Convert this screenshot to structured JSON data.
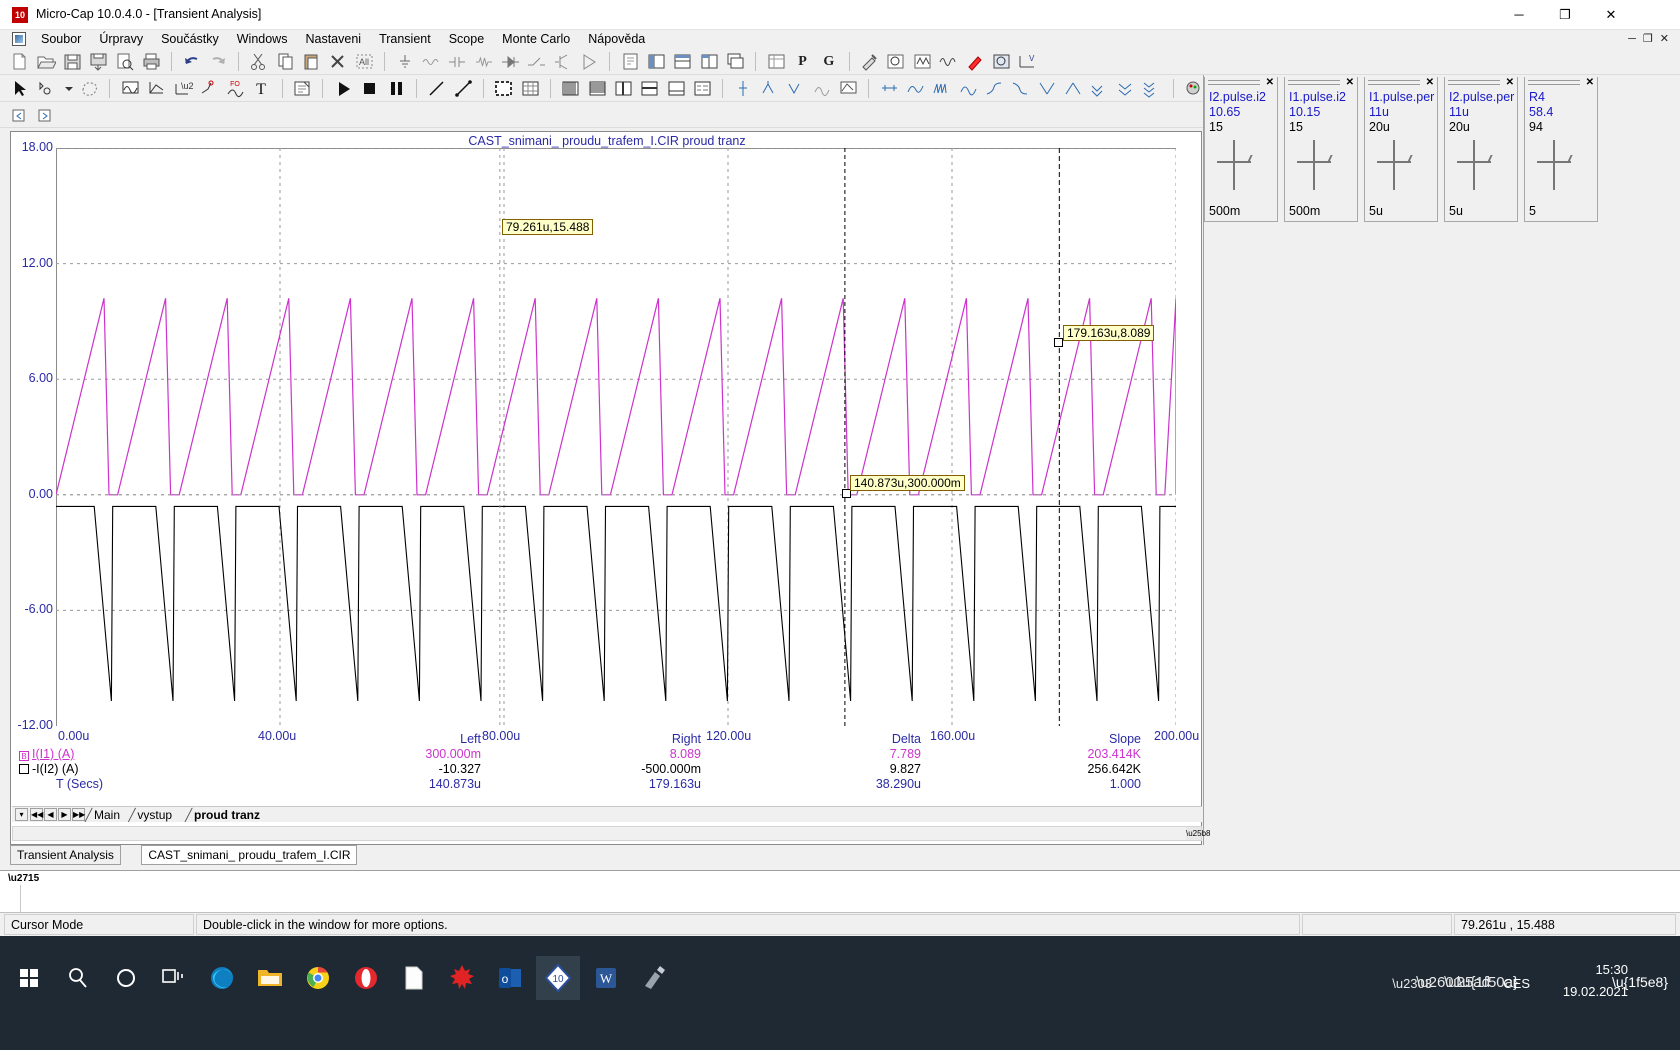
{
  "window": {
    "title": "Micro-Cap 10.0.4.0 - [Transient Analysis]",
    "app_badge": "10",
    "minimize": "─",
    "maximize": "❐",
    "close": "✕",
    "mdi_minimize": "─",
    "mdi_restore": "❐",
    "mdi_close": "✕"
  },
  "menu": {
    "items": [
      {
        "label": "Soubor"
      },
      {
        "label": "Úrpravy"
      },
      {
        "label": "Součástky"
      },
      {
        "label": "Windows"
      },
      {
        "label": "Nastaveni"
      },
      {
        "label": "Transient"
      },
      {
        "label": "Scope"
      },
      {
        "label": "Monte Carlo"
      },
      {
        "label": "Nápověda"
      }
    ]
  },
  "toolbar_text": {
    "probe_p": "P",
    "probe_g": "G",
    "quote_p": "'P'",
    "font_f": "F"
  },
  "sliders": [
    {
      "name": "I2.pulse.i2",
      "value": "10.65",
      "max": "15",
      "min": "500m"
    },
    {
      "name": "I1.pulse.i2",
      "value": "10.15",
      "max": "15",
      "min": "500m"
    },
    {
      "name": "I1.pulse.per",
      "value": "11u",
      "max": "20u",
      "min": "5u"
    },
    {
      "name": "I2.pulse.per",
      "value": "11u",
      "max": "20u",
      "min": "5u"
    },
    {
      "name": "R4",
      "value": "58.4",
      "max": "94",
      "min": "5"
    }
  ],
  "plot": {
    "title": "CAST_snimani_ proudu_trafem_I.CIR proud tranz",
    "y_ticks": [
      "18.00",
      "12.00",
      "6.00",
      "0.00",
      "-6.00",
      "-12.00"
    ],
    "x_ticks": [
      "0.00u",
      "40.00u",
      "80.00u",
      "120.00u",
      "160.00u",
      "200.00u"
    ],
    "tooltips": [
      {
        "text": "79.261u,15.488"
      },
      {
        "text": "140.873u,300.000m"
      },
      {
        "text": "179.163u,8.089"
      }
    ]
  },
  "chart_data": {
    "type": "line",
    "title": "CAST_snimani_ proudu_trafem_I.CIR proud tranz",
    "xlabel": "T (Secs)",
    "ylabel": "",
    "xlim": [
      0,
      200
    ],
    "ylim": [
      -12,
      18
    ],
    "x_unit": "u",
    "grid": true,
    "x_ticks": [
      0,
      40,
      80,
      120,
      160,
      200
    ],
    "y_ticks": [
      18,
      12,
      6,
      0,
      -6,
      -12
    ],
    "series": [
      {
        "name": "I(I1) (A)",
        "color": "#cc33cc",
        "description": "Sawtooth current ramp rising from 0 to about 10.2 A then dropping sharply to 0; period 11 us",
        "period_us": 11,
        "peak": 10.2,
        "baseline": 0.0
      },
      {
        "name": "-I(I2) (A)",
        "color": "#000000",
        "description": "Inverted sawtooth falling from about -0.6 to -10.7 A then jumping back; period 11 us",
        "period_us": 11,
        "peak": -0.6,
        "baseline": -10.7
      }
    ]
  },
  "readout": {
    "columns": [
      "Left",
      "Right",
      "Delta",
      "Slope"
    ],
    "rows": [
      {
        "label": "I(I1) (A)",
        "marker": "B",
        "color": "#cc33cc",
        "left": "300.000m",
        "right": "8.089",
        "delta": "7.789",
        "slope": "203.414K"
      },
      {
        "label": "-I(I2) (A)",
        "marker": "",
        "color": "#000000",
        "left": "-10.327",
        "right": "-500.000m",
        "delta": "9.827",
        "slope": "256.642K"
      },
      {
        "label": "T (Secs)",
        "marker": "",
        "color": "#2a2aa5",
        "left": "140.873u",
        "right": "179.163u",
        "delta": "38.290u",
        "slope": "1.000"
      }
    ]
  },
  "page_tabs": {
    "first": "◀◀",
    "prev": "◀",
    "next": "▶",
    "last": "▶▶",
    "dropdown": "▾",
    "items": [
      {
        "label": "Main",
        "active": false
      },
      {
        "label": "vystup",
        "active": false
      },
      {
        "label": "proud tranz",
        "active": true
      }
    ]
  },
  "doc_tabs": [
    {
      "label": "Transient Analysis",
      "selected": false
    },
    {
      "label": "CAST_snimani_ proudu_trafem_I.CIR",
      "selected": true
    }
  ],
  "statusbar": {
    "mode": "Cursor Mode",
    "hint": "Double-click in the window for more options.",
    "field3": "",
    "coords": "79.261u , 15.488"
  },
  "taskbar": {
    "items": [
      {
        "name": "start-button",
        "glyph": "windows"
      },
      {
        "name": "search-button",
        "glyph": "search"
      },
      {
        "name": "cortana-button",
        "glyph": "circle"
      },
      {
        "name": "task-view-button",
        "glyph": "taskview"
      },
      {
        "name": "edge-button",
        "glyph": "edge"
      },
      {
        "name": "file-explorer-button",
        "glyph": "folder"
      },
      {
        "name": "chrome-button",
        "glyph": "chrome"
      },
      {
        "name": "opera-button",
        "glyph": "opera"
      },
      {
        "name": "notepad-button",
        "glyph": "doc"
      },
      {
        "name": "maple-button",
        "glyph": "maple"
      },
      {
        "name": "outlook-button",
        "glyph": "outlook"
      },
      {
        "name": "microcap-button",
        "glyph": "microcap",
        "active": true
      },
      {
        "name": "word-button",
        "glyph": "word"
      },
      {
        "name": "sketch-button",
        "glyph": "sketch"
      }
    ],
    "language": "CES",
    "time": "15:30",
    "date": "19.02.2021"
  }
}
